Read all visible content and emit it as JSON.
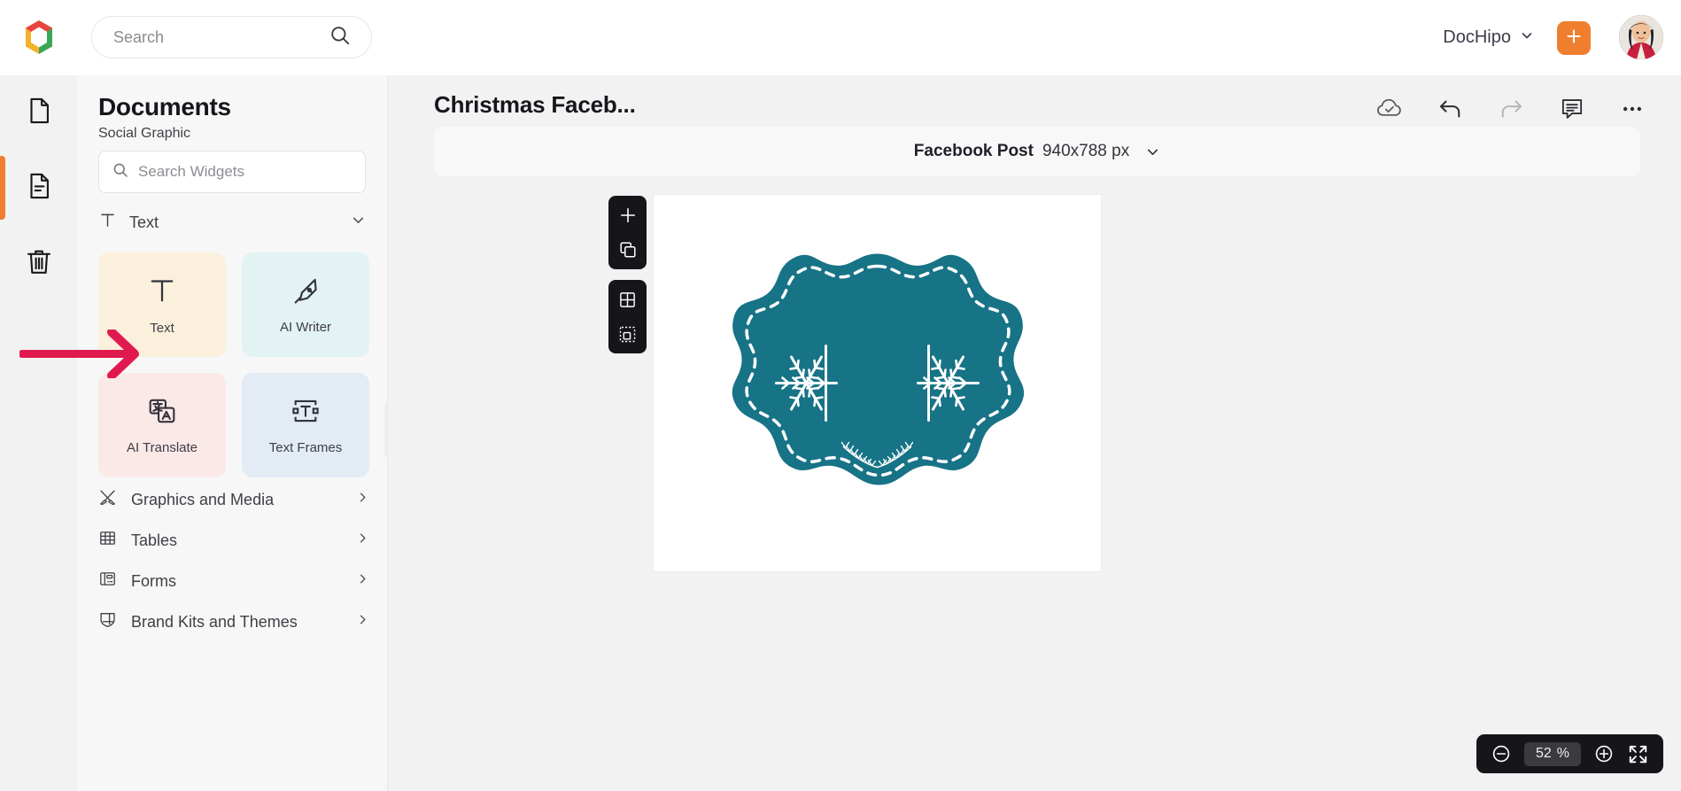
{
  "topbar": {
    "logo_icon": "dochipo-logo-icon",
    "search": {
      "placeholder": "Search",
      "value": "",
      "icon": "search-icon"
    },
    "brand": {
      "label": "DocHipo",
      "chevron_icon": "chevron-down-icon"
    },
    "add_button": {
      "icon": "plus-icon",
      "color": "#ef7f2e"
    },
    "avatar": {
      "name": "user-avatar"
    }
  },
  "rail": {
    "items": [
      {
        "icon": "document-icon",
        "name": "documents",
        "active": false
      },
      {
        "icon": "template-page-icon",
        "name": "templates",
        "active": true
      },
      {
        "icon": "trash-icon",
        "name": "trash",
        "active": false
      }
    ],
    "active_color": "#ef7f2e"
  },
  "sidebar": {
    "title": "Documents",
    "subtitle": "Social Graphic",
    "search": {
      "placeholder": "Search Widgets",
      "value": "",
      "icon": "search-icon"
    },
    "section": {
      "label": "Text",
      "icon": "text-t-icon",
      "chevron_icon": "chevron-down-icon",
      "expanded": true
    },
    "cards": [
      {
        "label": "Text",
        "icon": "text-t-icon",
        "bg": "#FBF0DC",
        "highlighted": true
      },
      {
        "label": "AI Writer",
        "icon": "pen-nib-icon",
        "bg": "#E3F3F3",
        "highlighted": false
      },
      {
        "label": "AI Translate",
        "icon": "translate-icon",
        "bg": "#FBE9E7",
        "highlighted": false
      },
      {
        "label": "Text Frames",
        "icon": "text-frame-icon",
        "bg": "#E3ECF5",
        "highlighted": false
      }
    ],
    "menu": [
      {
        "label": "Graphics and Media",
        "icon": "graphics-media-icon",
        "chevron_icon": "chevron-right-icon"
      },
      {
        "label": "Tables",
        "icon": "table-grid-icon",
        "chevron_icon": "chevron-right-icon"
      },
      {
        "label": "Forms",
        "icon": "forms-icon",
        "chevron_icon": "chevron-right-icon"
      },
      {
        "label": "Brand Kits and Themes",
        "icon": "brand-kit-icon",
        "chevron_icon": "chevron-right-icon"
      }
    ],
    "collapse": {
      "icon": "chevron-left-icon"
    }
  },
  "annotation": {
    "arrow": {
      "name": "pointer-arrow",
      "color": "#E01A4F",
      "points_to": "Text"
    }
  },
  "editor": {
    "document_title": "Christmas Faceb...",
    "tools": [
      {
        "name": "cloud-saved-icon",
        "state": "saved"
      },
      {
        "name": "undo-icon",
        "state": "enabled"
      },
      {
        "name": "redo-icon",
        "state": "disabled"
      },
      {
        "name": "comment-icon",
        "state": "enabled"
      },
      {
        "name": "more-options-icon",
        "state": "enabled"
      }
    ],
    "canvas_size": {
      "name": "Facebook Post",
      "dimensions": "940x788 px",
      "chevron_icon": "chevron-down-icon"
    },
    "page_tools": [
      [
        {
          "name": "add-page-icon",
          "label": "plus"
        },
        {
          "name": "duplicate-page-icon",
          "label": "copy"
        }
      ],
      [
        {
          "name": "grid-layout-icon",
          "label": "grid"
        },
        {
          "name": "select-area-icon",
          "label": "select"
        }
      ]
    ],
    "canvas": {
      "background": "#ffffff",
      "artwork": {
        "name": "christmas-badge",
        "shape": "scalloped-rosette",
        "fill": "#177386",
        "border": "dashed-white",
        "decorations": [
          "snowflake-left",
          "snowflake-right",
          "laurel-wreath-bottom"
        ]
      }
    },
    "zoom": {
      "out_icon": "zoom-out-icon",
      "value": "52",
      "unit": "%",
      "in_icon": "zoom-in-icon",
      "fit_icon": "fit-screen-icon"
    }
  }
}
